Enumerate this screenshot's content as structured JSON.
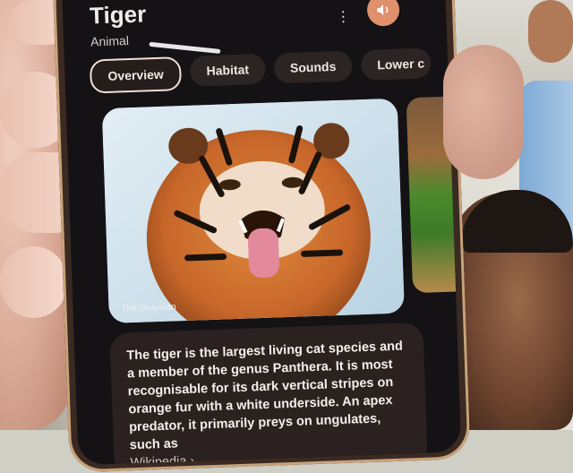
{
  "app": {
    "title": "Tiger",
    "subtitle": "Animal",
    "menu_icon": "more-vert-icon",
    "speaker_icon": "volume-icon",
    "accent_color": "#e0906a"
  },
  "tabs": [
    {
      "label": "Overview",
      "active": true
    },
    {
      "label": "Habitat",
      "active": false
    },
    {
      "label": "Sounds",
      "active": false
    },
    {
      "label": "Lower c",
      "active": false
    }
  ],
  "images": {
    "main_credit": "The Guardian"
  },
  "description": {
    "text": "The tiger is the largest living cat species and a member of the genus Panthera. It is most recognisable for its dark vertical stripes on orange fur with a white underside. An apex predator, it primarily preys on ungulates, such as",
    "source": "Wikipedia ›"
  }
}
